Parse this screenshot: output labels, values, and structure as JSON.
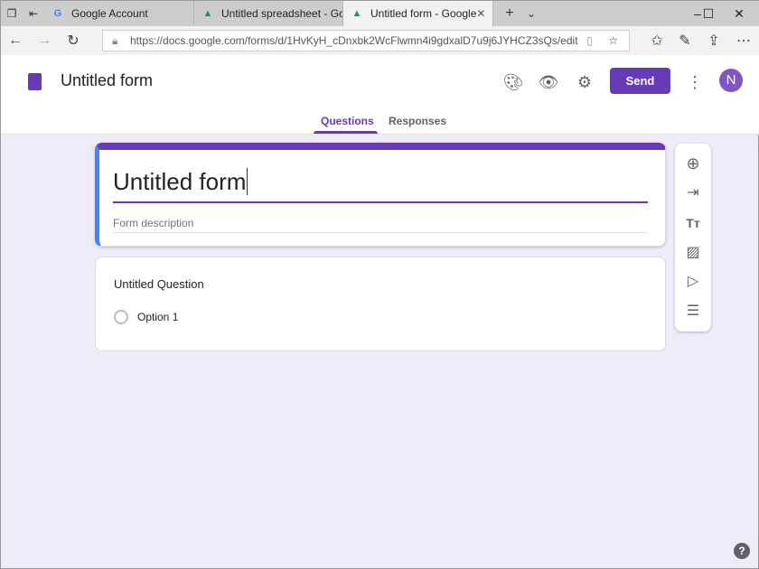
{
  "browser": {
    "tabs": [
      {
        "label": "Google Account",
        "icon": "google-icon"
      },
      {
        "label": "Untitled spreadsheet - Goog",
        "icon": "drive-icon"
      },
      {
        "label": "Untitled form - Google",
        "icon": "drive-icon",
        "active": true
      }
    ],
    "url": "https://docs.google.com/forms/d/1HvKyH_cDnxbk2WcFlwmn4i9gdxalD7u9j6JYHCZ3sQs/edit"
  },
  "header": {
    "title": "Untitled form",
    "send_label": "Send",
    "avatar_letter": "N",
    "tabs": [
      "Questions",
      "Responses"
    ],
    "active_tab": "Questions"
  },
  "form": {
    "title": "Untitled form",
    "description_placeholder": "Form description",
    "question": {
      "title": "Untitled Question",
      "options": [
        "Option 1"
      ]
    }
  },
  "colors": {
    "accent": "#673ab7",
    "background": "#f0ebf8",
    "focus_left": "#4285f4"
  }
}
